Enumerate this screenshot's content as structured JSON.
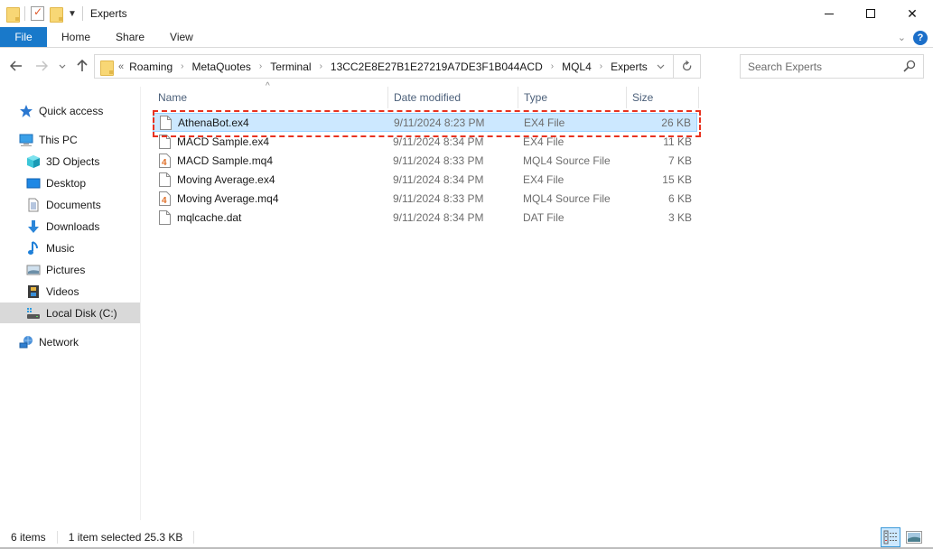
{
  "window": {
    "title": "Experts",
    "controls": {
      "minimize": "Minimize",
      "maximize": "Maximize",
      "close": "✕"
    }
  },
  "ribbon": {
    "tabs": [
      "File",
      "Home",
      "Share",
      "View"
    ],
    "help": "?",
    "expand": "⌄"
  },
  "address": {
    "overflow": "«",
    "crumbs": [
      "Roaming",
      "MetaQuotes",
      "Terminal",
      "13CC2E8E27B1E27219A7DE3F1B044ACD",
      "MQL4",
      "Experts"
    ],
    "separator": "›"
  },
  "search": {
    "placeholder": "Search Experts",
    "value": ""
  },
  "navpane": {
    "items": [
      {
        "label": "Quick access",
        "icon": "star-icon"
      },
      {
        "label": "This PC",
        "icon": "computer-icon"
      },
      {
        "label": "3D Objects",
        "icon": "cube-icon"
      },
      {
        "label": "Desktop",
        "icon": "desktop-icon"
      },
      {
        "label": "Documents",
        "icon": "documents-icon"
      },
      {
        "label": "Downloads",
        "icon": "download-arrow-icon"
      },
      {
        "label": "Music",
        "icon": "music-note-icon"
      },
      {
        "label": "Pictures",
        "icon": "pictures-icon"
      },
      {
        "label": "Videos",
        "icon": "film-icon"
      },
      {
        "label": "Local Disk (C:)",
        "icon": "drive-icon",
        "selected": true
      },
      {
        "label": "Network",
        "icon": "network-icon"
      }
    ]
  },
  "columns": [
    "Name",
    "Date modified",
    "Type",
    "Size"
  ],
  "files": [
    {
      "name": "AthenaBot.ex4",
      "date": "9/11/2024 8:23 PM",
      "type": "EX4 File",
      "size": "26 KB",
      "icon": "blank-file-icon",
      "selected": true
    },
    {
      "name": "MACD Sample.ex4",
      "date": "9/11/2024 8:34 PM",
      "type": "EX4 File",
      "size": "11 KB",
      "icon": "blank-file-icon"
    },
    {
      "name": "MACD Sample.mq4",
      "date": "9/11/2024 8:33 PM",
      "type": "MQL4 Source File",
      "size": "7 KB",
      "icon": "mql4-file-icon"
    },
    {
      "name": "Moving Average.ex4",
      "date": "9/11/2024 8:34 PM",
      "type": "EX4 File",
      "size": "15 KB",
      "icon": "blank-file-icon"
    },
    {
      "name": "Moving Average.mq4",
      "date": "9/11/2024 8:33 PM",
      "type": "MQL4 Source File",
      "size": "6 KB",
      "icon": "mql4-file-icon"
    },
    {
      "name": "mqlcache.dat",
      "date": "9/11/2024 8:34 PM",
      "type": "DAT File",
      "size": "3 KB",
      "icon": "blank-file-icon"
    }
  ],
  "status": {
    "item_count": "6 items",
    "selection": "1 item selected  25.3 KB"
  },
  "colors": {
    "accent": "#1979ca",
    "selection_bg": "#cce8ff",
    "selection_border": "#99d1ff",
    "annotation": "#e8321f"
  }
}
